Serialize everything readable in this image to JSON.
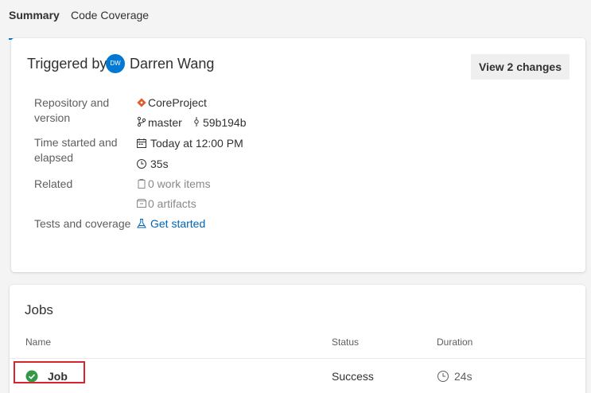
{
  "tabs": [
    {
      "label": "Summary",
      "active": true
    },
    {
      "label": "Code Coverage",
      "active": false
    }
  ],
  "summary": {
    "triggered_by_label": "Triggered by",
    "avatar_initials": "DW",
    "user_name": "Darren Wang",
    "view_changes_label": "View 2 changes",
    "repository": {
      "label": "Repository and version",
      "project": "CoreProject",
      "branch": "master",
      "commit": "59b194b"
    },
    "time": {
      "label": "Time started and elapsed",
      "started": "Today at 12:00 PM",
      "elapsed": "35s"
    },
    "related": {
      "label": "Related",
      "work_items": "0 work items",
      "artifacts": "0 artifacts"
    },
    "tests": {
      "label": "Tests and coverage",
      "link": "Get started"
    }
  },
  "jobs": {
    "title": "Jobs",
    "columns": [
      "Name",
      "Status",
      "Duration"
    ],
    "rows": [
      {
        "name": "Job",
        "status": "Success",
        "duration": "24s"
      }
    ]
  },
  "colors": {
    "accent": "#0078d4",
    "success": "#339947",
    "highlight": "#d9232e",
    "repo_icon": "#e05d2f"
  },
  "icons": {
    "repo": "git-repo-icon",
    "branch": "branch-icon",
    "commit": "commit-icon",
    "calendar": "calendar-icon",
    "clock": "clock-icon",
    "work_items": "work-item-icon",
    "artifacts": "artifact-icon",
    "tests": "flask-icon",
    "success": "check-circle-icon"
  }
}
